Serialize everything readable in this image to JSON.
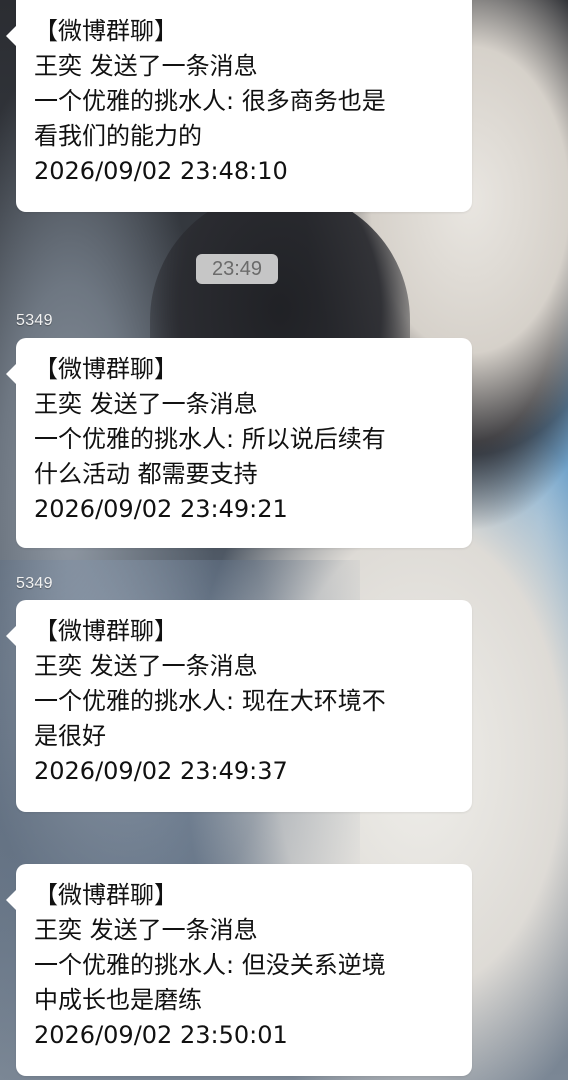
{
  "conversation": {
    "time_divider": "23:49",
    "messages": [
      {
        "sender_id": "",
        "lines": [
          "【微博群聊】",
          "王奕 发送了一条消息",
          "一个优雅的挑水人: 很多商务也是",
          "看我们的能力的",
          "2026/09/02 23:48:10"
        ]
      },
      {
        "sender_id": "5349",
        "lines": [
          "【微博群聊】",
          "王奕 发送了一条消息",
          "一个优雅的挑水人: 所以说后续有",
          "什么活动 都需要支持",
          "2026/09/02 23:49:21"
        ]
      },
      {
        "sender_id": "5349",
        "lines": [
          "【微博群聊】",
          "王奕 发送了一条消息",
          "一个优雅的挑水人: 现在大环境不",
          "是很好",
          "2026/09/02 23:49:37"
        ]
      },
      {
        "sender_id": "",
        "lines": [
          "【微博群聊】",
          "王奕 发送了一条消息",
          "一个优雅的挑水人: 但没关系逆境",
          "中成长也是磨练",
          "2026/09/02 23:50:01"
        ]
      }
    ]
  }
}
